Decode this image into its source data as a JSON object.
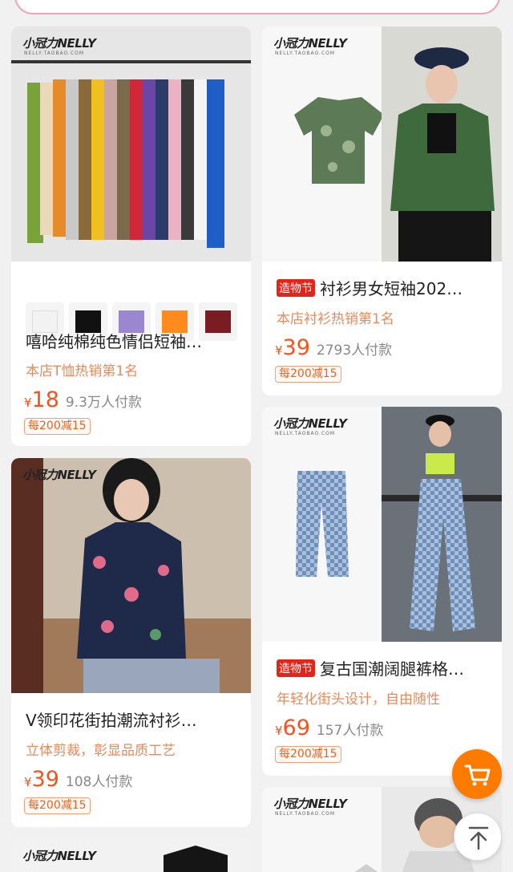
{
  "brand": {
    "name": "小冠力NELLY",
    "sub": "NELLY.TAOBAO.COM"
  },
  "products": [
    {
      "title": "嘻哈纯棉纯色情侣短袖…",
      "subtitle": "本店T恤热销第1名",
      "currency": "¥",
      "price": "18",
      "sold": "9.3万人付款",
      "promo": "每200减15",
      "tag": "",
      "thumb_colors": [
        "#f2f2f2",
        "#111111",
        "#9b86d0",
        "#ff8a1e",
        "#7a1c22"
      ]
    },
    {
      "title": "衬衫男女短袖202…",
      "subtitle": "本店衬衫热销第1名",
      "currency": "¥",
      "price": "39",
      "sold": "2793人付款",
      "promo": "每200减15",
      "tag": "造物节"
    },
    {
      "title": "复古国潮阔腿裤格…",
      "subtitle": "年轻化街头设计，自由随性",
      "currency": "¥",
      "price": "69",
      "sold": "157人付款",
      "promo": "每200减15",
      "tag": "造物节"
    },
    {
      "title": "V领印花街拍潮流衬衫…",
      "subtitle": "立体剪裁，彰显品质工艺",
      "currency": "¥",
      "price": "39",
      "sold": "108人付款",
      "promo": "每200减15",
      "tag": ""
    }
  ],
  "icons": {
    "cart": "cart-icon",
    "back_to_top": "arrow-up-icon"
  },
  "colors": {
    "accent": "#f5521c",
    "subtitle": "#e88a5c",
    "tag": "#e1251b",
    "cart_button": "#ff7b00"
  }
}
